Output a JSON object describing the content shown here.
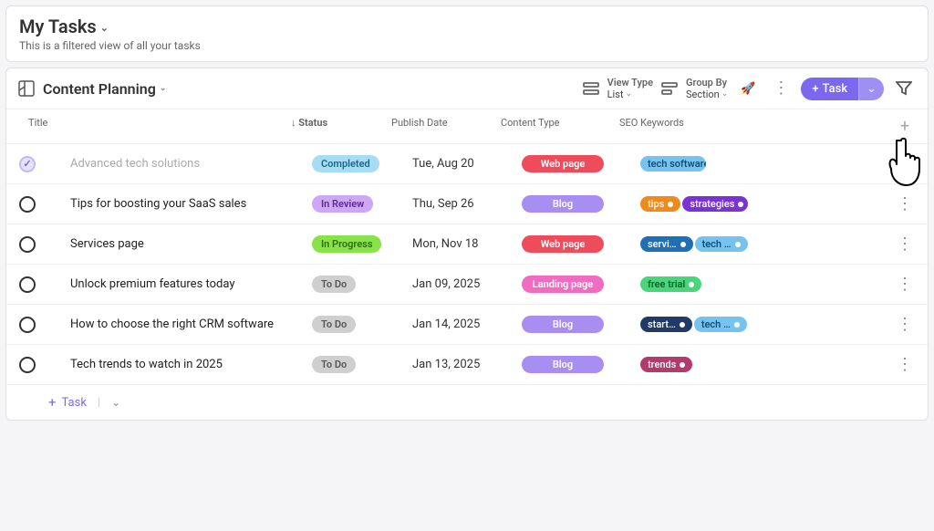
{
  "header": {
    "title": "My Tasks",
    "subtitle": "This is a filtered view of all your tasks"
  },
  "section": {
    "title": "Content Planning"
  },
  "toolbar": {
    "viewType": {
      "label": "View Type",
      "value": "List"
    },
    "groupBy": {
      "label": "Group By",
      "value": "Section"
    },
    "taskButtonLabel": "Task"
  },
  "columns": {
    "title": "Title",
    "status": "Status",
    "publishDate": "Publish Date",
    "contentType": "Content Type",
    "seoKeywords": "SEO Keywords"
  },
  "rows": [
    {
      "completed": true,
      "title": "Advanced tech solutions",
      "status": {
        "label": "Completed",
        "bg": "#a8dcf2",
        "fg": "#156a8a"
      },
      "date": "Tue, Aug 20",
      "content": {
        "label": "Web page",
        "bg": "#ef4c5b",
        "fg": "#ffffff"
      },
      "seo": [
        {
          "label": "tech software",
          "bg": "#77c3f0",
          "fg": "#0b4870"
        }
      ]
    },
    {
      "completed": false,
      "title": "Tips for boosting your SaaS sales",
      "status": {
        "label": "In Review",
        "bg": "#cfa8f5",
        "fg": "#5a2a94"
      },
      "date": "Thu, Sep 26",
      "content": {
        "label": "Blog",
        "bg": "#a88ef0",
        "fg": "#ffffff"
      },
      "seo": [
        {
          "label": "tips",
          "bg": "#f08a1d",
          "fg": "#ffffff"
        },
        {
          "label": "strategies",
          "bg": "#7b32d4",
          "fg": "#ffffff"
        }
      ]
    },
    {
      "completed": false,
      "title": "Services page",
      "status": {
        "label": "In Progress",
        "bg": "#89e24a",
        "fg": "#2f6b0d"
      },
      "date": "Mon, Nov 18",
      "content": {
        "label": "Web page",
        "bg": "#ef4c5b",
        "fg": "#ffffff"
      },
      "seo": [
        {
          "label": "servi…",
          "bg": "#1e6fb3",
          "fg": "#ffffff"
        },
        {
          "label": "tech …",
          "bg": "#77c3f0",
          "fg": "#0b4870"
        }
      ]
    },
    {
      "completed": false,
      "title": "Unlock premium features today",
      "status": {
        "label": "To Do",
        "bg": "#cfcfcf",
        "fg": "#555555"
      },
      "date": "Jan 09, 2025",
      "content": {
        "label": "Landing page",
        "bg": "#f06cc1",
        "fg": "#ffffff"
      },
      "seo": [
        {
          "label": "free trial",
          "bg": "#4bd47a",
          "fg": "#0d5a29"
        }
      ]
    },
    {
      "completed": false,
      "title": "How to choose the right CRM software",
      "status": {
        "label": "To Do",
        "bg": "#cfcfcf",
        "fg": "#555555"
      },
      "date": "Jan 14, 2025",
      "content": {
        "label": "Blog",
        "bg": "#a88ef0",
        "fg": "#ffffff"
      },
      "seo": [
        {
          "label": "start…",
          "bg": "#1f3b66",
          "fg": "#ffffff"
        },
        {
          "label": "tech …",
          "bg": "#77c3f0",
          "fg": "#0b4870"
        }
      ]
    },
    {
      "completed": false,
      "title": "Tech trends to watch in 2025",
      "status": {
        "label": "To Do",
        "bg": "#cfcfcf",
        "fg": "#555555"
      },
      "date": "Jan 13, 2025",
      "content": {
        "label": "Blog",
        "bg": "#a88ef0",
        "fg": "#ffffff"
      },
      "seo": [
        {
          "label": "trends",
          "bg": "#b33a6b",
          "fg": "#ffffff"
        }
      ]
    }
  ],
  "addRow": {
    "label": "Task"
  }
}
